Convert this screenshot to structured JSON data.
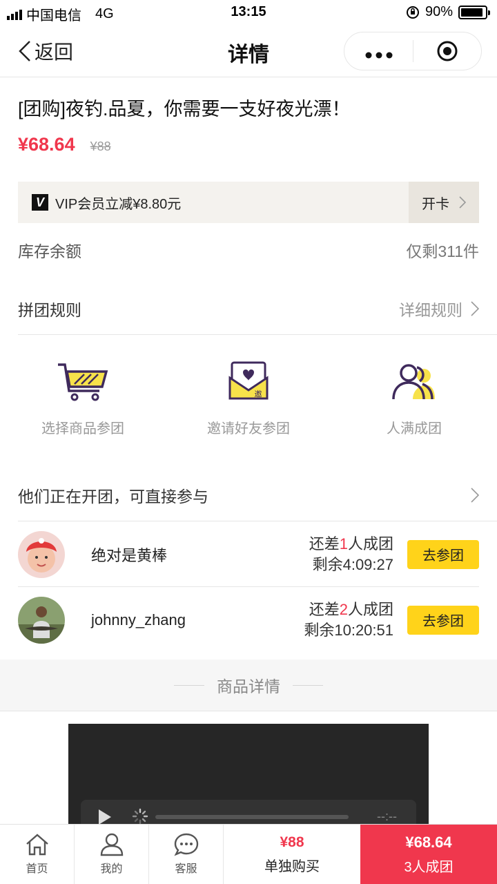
{
  "status_bar": {
    "carrier": "中国电信",
    "network": "4G",
    "time": "13:15",
    "battery": "90%",
    "battery_level": 0.9
  },
  "nav": {
    "back_label": "返回",
    "title": "详情"
  },
  "product": {
    "title": "[团购]夜钓.品夏，你需要一支好夜光漂！",
    "price": "¥68.64",
    "original_price": "¥88"
  },
  "vip": {
    "logo": "V",
    "text": "VIP会员立减¥8.80元",
    "action": "开卡"
  },
  "stock": {
    "label": "库存余额",
    "value": "仅剩311件"
  },
  "rules": {
    "label": "拼团规则",
    "link": "详细规则"
  },
  "steps": [
    {
      "label": "选择商品参团",
      "icon": "shopping-cart-icon"
    },
    {
      "label": "邀请好友参团",
      "icon": "invite-envelope-icon"
    },
    {
      "label": "人满成团",
      "icon": "group-people-icon"
    }
  ],
  "groups_section": {
    "title": "他们正在开团，可直接参与"
  },
  "groups": [
    {
      "name": "绝对是黄棒",
      "need_prefix": "还差",
      "need_count": "1",
      "need_suffix": "人成团",
      "remaining": "剩余4:09:27",
      "button": "去参团"
    },
    {
      "name": "johnny_zhang",
      "need_prefix": "还差",
      "need_count": "2",
      "need_suffix": "人成团",
      "remaining": "剩余10:20:51",
      "button": "去参团"
    }
  ],
  "detail_section": {
    "title": "商品详情"
  },
  "video": {
    "time": "--:--"
  },
  "tabbar": {
    "home": "首页",
    "mine": "我的",
    "service": "客服",
    "single_price": "¥88",
    "single_label": "单独购买",
    "group_price": "¥68.64",
    "group_label": "3人成团"
  },
  "colors": {
    "accent_red": "#f0374d",
    "button_yellow": "#ffd31a",
    "icon_purple": "#3f2a5c"
  }
}
